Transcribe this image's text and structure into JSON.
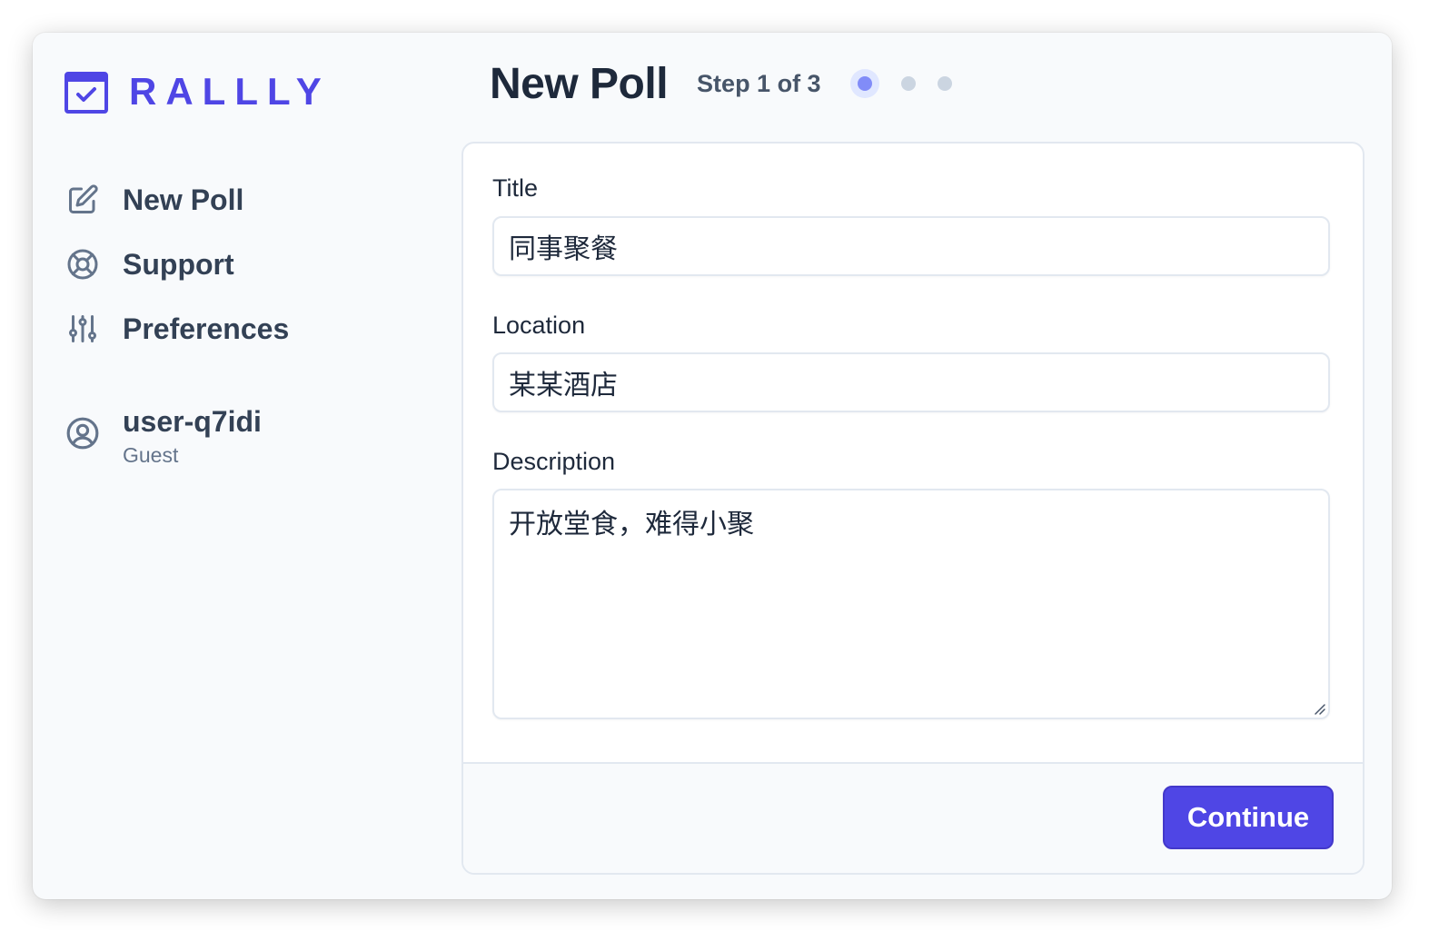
{
  "app": {
    "logo_text": "RALLLY",
    "brand_color": "#4f46e5"
  },
  "sidebar": {
    "items": [
      {
        "label": "New Poll",
        "icon": "pencil-square-icon"
      },
      {
        "label": "Support",
        "icon": "life-ring-icon"
      },
      {
        "label": "Preferences",
        "icon": "sliders-icon"
      }
    ],
    "user": {
      "name": "user-q7idi",
      "role": "Guest",
      "icon": "user-circle-icon"
    }
  },
  "header": {
    "title": "New Poll",
    "step_text": "Step 1 of 3",
    "current_step": 1,
    "total_steps": 3
  },
  "form": {
    "title_label": "Title",
    "title_value": "同事聚餐",
    "location_label": "Location",
    "location_value": "某某酒店",
    "description_label": "Description",
    "description_value": "开放堂食，难得小聚"
  },
  "footer": {
    "continue_label": "Continue"
  }
}
